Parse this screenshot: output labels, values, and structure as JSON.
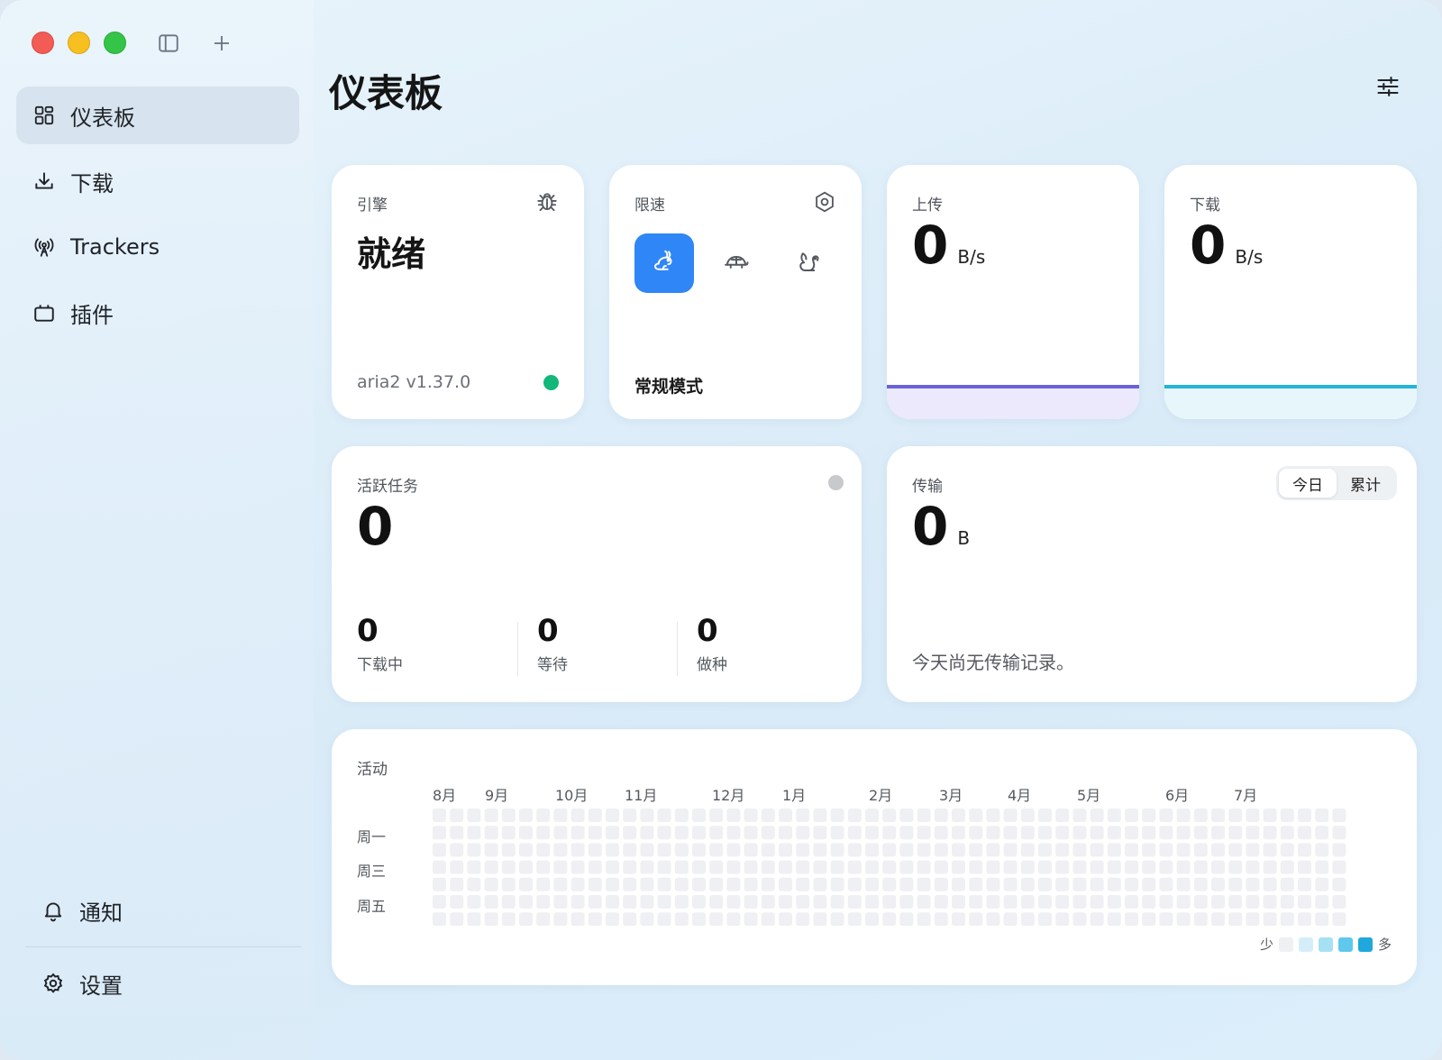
{
  "sidebar": {
    "items": [
      {
        "label": "仪表板",
        "icon": "dashboard-icon",
        "active": true
      },
      {
        "label": "下载",
        "icon": "download-icon",
        "active": false
      },
      {
        "label": "Trackers",
        "icon": "broadcast-icon",
        "active": false
      },
      {
        "label": "插件",
        "icon": "plugin-icon",
        "active": false
      }
    ],
    "bottom": [
      {
        "label": "通知",
        "icon": "bell-icon"
      },
      {
        "label": "设置",
        "icon": "gear-icon"
      }
    ]
  },
  "header": {
    "title": "仪表板"
  },
  "engine": {
    "label": "引擎",
    "status": "就绪",
    "version": "aria2 v1.37.0",
    "status_color": "#11b87a"
  },
  "speed_limit": {
    "label": "限速",
    "mode": "常规模式",
    "selected": "rabbit-icon",
    "options": [
      "rabbit-icon",
      "turtle-icon",
      "squirrel-icon"
    ],
    "accent": "#2f86f6"
  },
  "upload": {
    "label": "上传",
    "value": "0",
    "unit": "B/s",
    "line_color": "#6b62d8"
  },
  "download": {
    "label": "下载",
    "value": "0",
    "unit": "B/s",
    "line_color": "#23b5d6"
  },
  "active_tasks": {
    "label": "活跃任务",
    "value": "0",
    "sub": [
      {
        "value": "0",
        "label": "下载中"
      },
      {
        "value": "0",
        "label": "等待"
      },
      {
        "value": "0",
        "label": "做种"
      }
    ]
  },
  "transfer": {
    "label": "传输",
    "value": "0",
    "unit": "B",
    "tabs": [
      "今日",
      "累计"
    ],
    "active_tab": "今日",
    "empty": "今天尚无传输记录。"
  },
  "activity": {
    "label": "活动",
    "months": [
      "8月",
      "9月",
      "10月",
      "11月",
      "12月",
      "1月",
      "2月",
      "3月",
      "4月",
      "5月",
      "6月",
      "7月"
    ],
    "days": [
      "周一",
      "周三",
      "周五"
    ],
    "legend_less": "少",
    "legend_more": "多",
    "legend_colors": [
      "#eef0f3",
      "#d3eef8",
      "#a6e0f3",
      "#5fc8ec",
      "#20a7dc"
    ]
  }
}
